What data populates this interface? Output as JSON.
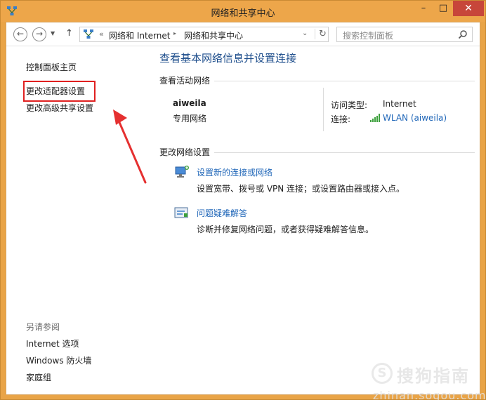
{
  "window": {
    "title": "网络和共享中心",
    "minimize_glyph": "–",
    "maximize_glyph": "□",
    "close_glyph": "✕"
  },
  "nav": {
    "back_glyph": "←",
    "forward_glyph": "→",
    "recent_glyph": "▼",
    "up_glyph": "↑"
  },
  "address": {
    "overflow_glyph": "«",
    "crumb1": "网络和 Internet",
    "separator_glyph": "▸",
    "crumb2": "网络和共享中心",
    "dropdown_glyph": "⌄",
    "refresh_glyph": "↻"
  },
  "search": {
    "placeholder": "搜索控制面板"
  },
  "sidebar": {
    "home": "控制面板主页",
    "adapter": "更改适配器设置",
    "advanced": "更改高级共享设置",
    "see_also": "另请参阅",
    "internet_options": "Internet 选项",
    "firewall": "Windows 防火墙",
    "homegroup": "家庭组"
  },
  "main": {
    "title": "查看基本网络信息并设置连接",
    "active_networks_label": "查看活动网络",
    "network_name": "aiweila",
    "network_category": "专用网络",
    "access_type_label": "访问类型:",
    "access_type_value": "Internet",
    "connection_label": "连接:",
    "connection_value": "WLAN (aiweila)",
    "change_settings_label": "更改网络设置",
    "task1_link": "设置新的连接或网络",
    "task1_desc": "设置宽带、拨号或 VPN 连接；或设置路由器或接入点。",
    "task2_link": "问题疑难解答",
    "task2_desc": "诊断并修复网络问题，或者获得疑难解答信息。"
  },
  "watermark": {
    "logo_glyph": "S",
    "brand": "搜狗指南",
    "url": "zhinan.sogou.com"
  },
  "colors": {
    "frame": "#eda64a",
    "link": "#1f66b8",
    "title_blue": "#1e4e8c",
    "highlight": "#e02020",
    "close_button": "#c7463a"
  }
}
